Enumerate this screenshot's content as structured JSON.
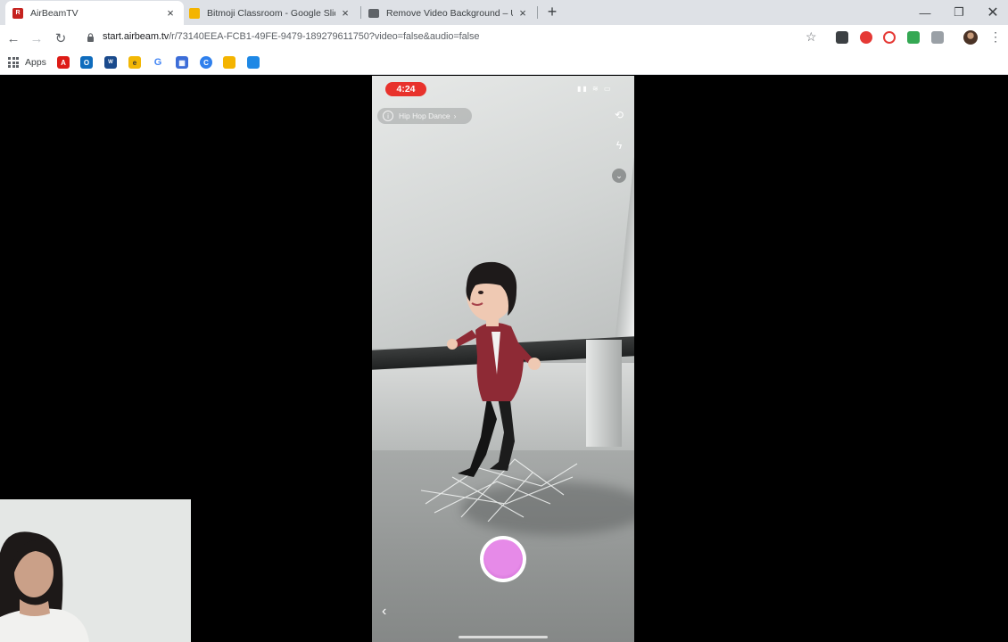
{
  "tabs": [
    {
      "title": "AirBeamTV",
      "active": true,
      "favicon_color": "#c5221f"
    },
    {
      "title": "Bitmoji Classroom - Google Slides",
      "active": false,
      "favicon_color": "#f4b400"
    },
    {
      "title": "Remove Video Background – Unscreen",
      "active": false,
      "favicon_color": "#5f6368"
    }
  ],
  "toolbar": {
    "url_host": "start.airbeam.tv",
    "url_path": "/r/73140EEA-FCB1-49FE-9479-189279611750?video=false&audio=false"
  },
  "bookmarks": {
    "apps_label": "Apps",
    "icons": [
      {
        "name": "angular-bookmark",
        "color": "#dd1b16",
        "glyph": "A"
      },
      {
        "name": "outlook-bookmark",
        "color": "#0f6cbd",
        "glyph": "O"
      },
      {
        "name": "wsu-bookmark",
        "color": "#1a4a8c",
        "glyph": "W"
      },
      {
        "name": "edpuzzle-bookmark",
        "color": "#f2b705",
        "glyph": "e"
      },
      {
        "name": "google-bookmark",
        "color": "#ffffff",
        "glyph": "G"
      },
      {
        "name": "grid-bookmark",
        "color": "#3c6dd8",
        "glyph": "▦"
      },
      {
        "name": "c-bookmark",
        "color": "#2f80ed",
        "glyph": "C"
      },
      {
        "name": "slides-bookmark",
        "color": "#f4b400",
        "glyph": ""
      },
      {
        "name": "classroom-bookmark",
        "color": "#1e88e5",
        "glyph": ""
      }
    ]
  },
  "phone": {
    "time": "4:24",
    "lens_name": "Hip Hop Dance",
    "lens_arrow": "›"
  },
  "colors": {
    "record_red": "#e8322c",
    "capture_purple": "#e68ae8"
  }
}
